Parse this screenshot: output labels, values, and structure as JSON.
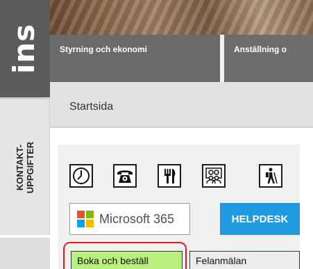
{
  "brand": {
    "text": "ins"
  },
  "sidebar": {
    "contact_label": "KONTAKT-\nUPPGIFTER"
  },
  "nav": {
    "tabs": [
      {
        "label": "Styrning och ekonomi"
      },
      {
        "label": "Anställning o"
      }
    ]
  },
  "page": {
    "title": "Startsida"
  },
  "quicklinks": {
    "icons": [
      "clock-icon",
      "telephone-icon",
      "cutlery-icon",
      "people-icon",
      "hiker-icon"
    ],
    "microsoft": {
      "label": "Microsoft 365",
      "logo_colors": [
        "#f25022",
        "#7fba00",
        "#00a4ef",
        "#ffb900"
      ]
    },
    "helpdesk": {
      "label": "HELPDESK",
      "color": "#1f9ae0"
    },
    "boka": {
      "label": "Boka och beställ",
      "color": "#b9ef7f"
    },
    "felanmalan": {
      "label": "Felanmälan"
    }
  },
  "highlight_color": "#e01e1e"
}
